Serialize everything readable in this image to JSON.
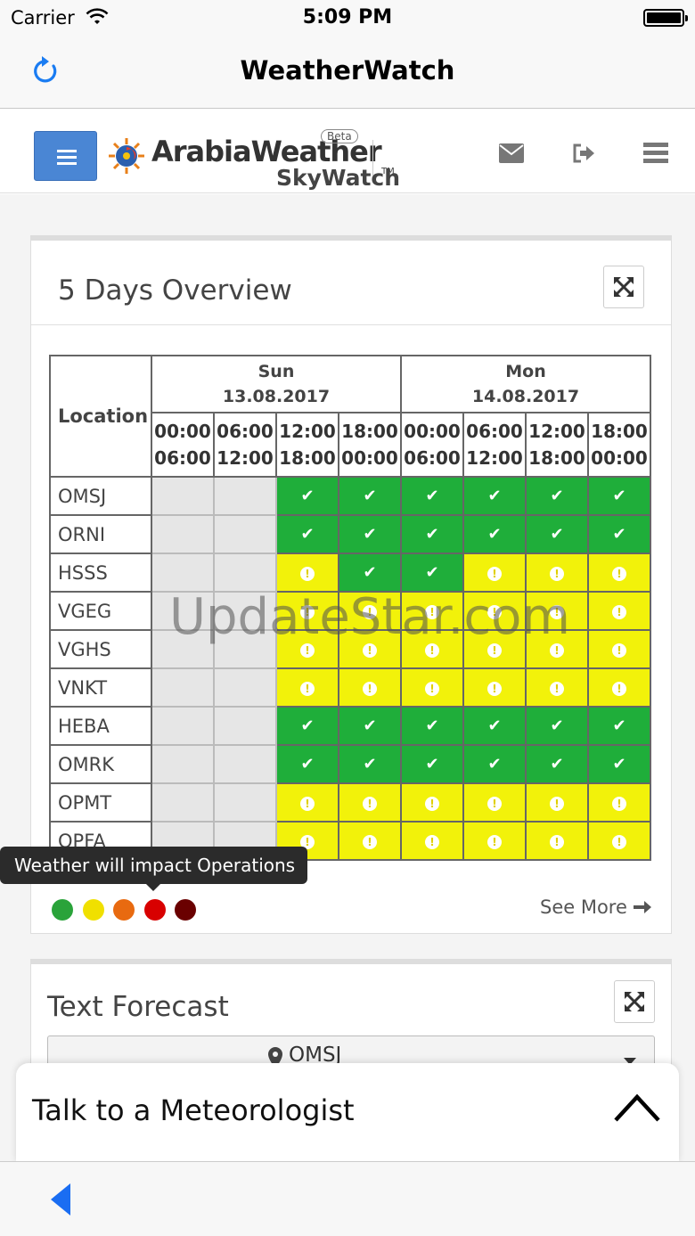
{
  "status_bar": {
    "carrier": "Carrier",
    "time": "5:09 PM"
  },
  "nav": {
    "title": "WeatherWatch",
    "refresh_icon": "refresh-icon"
  },
  "brand": {
    "name": "ArabiaWeather",
    "product": "SkyWatch",
    "badge": "Beta",
    "trademark": "TM"
  },
  "overview": {
    "title": "5 Days Overview",
    "location_header": "Location",
    "days": [
      {
        "name": "Sun",
        "date": "13.08.2017"
      },
      {
        "name": "Mon",
        "date": "14.08.2017"
      }
    ],
    "slots": [
      [
        "00:00",
        "06:00"
      ],
      [
        "06:00",
        "12:00"
      ],
      [
        "12:00",
        "18:00"
      ],
      [
        "18:00",
        "00:00"
      ],
      [
        "00:00",
        "06:00"
      ],
      [
        "06:00",
        "12:00"
      ],
      [
        "12:00",
        "18:00"
      ],
      [
        "18:00",
        "00:00"
      ]
    ],
    "rows": [
      {
        "location": "OMSJ",
        "cells": [
          "na",
          "na",
          "g",
          "g",
          "g",
          "g",
          "g",
          "g"
        ]
      },
      {
        "location": "ORNI",
        "cells": [
          "na",
          "na",
          "g",
          "g",
          "g",
          "g",
          "g",
          "g"
        ]
      },
      {
        "location": "HSSS",
        "cells": [
          "na",
          "na",
          "y",
          "g",
          "g",
          "y",
          "y",
          "y"
        ]
      },
      {
        "location": "VGEG",
        "cells": [
          "na",
          "na",
          "y",
          "y",
          "y",
          "y",
          "y",
          "y"
        ]
      },
      {
        "location": "VGHS",
        "cells": [
          "na",
          "na",
          "y",
          "y",
          "y",
          "y",
          "y",
          "y"
        ]
      },
      {
        "location": "VNKT",
        "cells": [
          "na",
          "na",
          "y",
          "y",
          "y",
          "y",
          "y",
          "y"
        ]
      },
      {
        "location": "HEBA",
        "cells": [
          "na",
          "na",
          "g",
          "g",
          "g",
          "g",
          "g",
          "g"
        ]
      },
      {
        "location": "OMRK",
        "cells": [
          "na",
          "na",
          "g",
          "g",
          "g",
          "g",
          "g",
          "g"
        ]
      },
      {
        "location": "OPMT",
        "cells": [
          "na",
          "na",
          "y",
          "y",
          "y",
          "y",
          "y",
          "y"
        ]
      },
      {
        "location": "OPFA",
        "cells": [
          "na",
          "na",
          "y",
          "y",
          "y",
          "y",
          "y",
          "y"
        ]
      }
    ],
    "tooltip": "Weather will impact Operations",
    "legend_colors": [
      "#2aa33a",
      "#f0e000",
      "#e86a10",
      "#d80000",
      "#6a0000"
    ],
    "see_more": "See More",
    "watermark": "UpdateStar.com"
  },
  "text_forecast": {
    "title": "Text Forecast",
    "selected_location": "OMSJ"
  },
  "talk_bar": {
    "label": "Talk to a Meteorologist"
  }
}
